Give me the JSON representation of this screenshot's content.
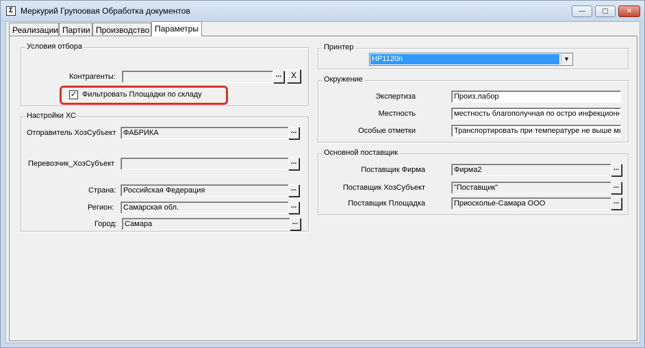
{
  "window": {
    "title": "Меркурий Групоовая Обработка документов",
    "app_icon_glyph": "Σ",
    "minimize_glyph": "—",
    "maximize_glyph": "▢",
    "close_glyph": "✕"
  },
  "tabs": [
    {
      "label": "Реализации"
    },
    {
      "label": "Партии"
    },
    {
      "label": "Производство"
    },
    {
      "label": "Параметры"
    }
  ],
  "active_tab": "Параметры",
  "selection_conditions": {
    "title": "Условия отбора",
    "counterparties_label": "Контрагенты:",
    "counterparties_value": "",
    "dots": "...",
    "clear": "X",
    "filter_checkbox_label": "Фильтровать Площадки по складу",
    "filter_checked": true,
    "check_glyph": "✓"
  },
  "hs_settings": {
    "title": "Настройки ХС",
    "sender_label": "Отправитель ХозСубъект",
    "sender_value": "ФАБРИКА",
    "carrier_label": "Перевозчик_ХозСубъект",
    "carrier_value": "",
    "country_label": "Страна:",
    "country_value": "Российская Федерация",
    "region_label": "Регион:",
    "region_value": "Самарская обл.",
    "city_label": "Город:",
    "city_value": "Самара"
  },
  "printer": {
    "title": "Принтер",
    "selected": "HP1120n",
    "arrow_glyph": "▼"
  },
  "environment": {
    "title": "Окружение",
    "expertise_label": "Экспертиза",
    "expertise_value": "Произ.лабор",
    "locality_label": "Местность",
    "locality_value": "местность благополучная по остро инфекционн",
    "notes_label": "Особые отметки",
    "notes_value": "Транспортировать при температуре не выше ми"
  },
  "main_supplier": {
    "title": "Основной поставщик",
    "firm_label": "Поставщик Фирма",
    "firm_value": "Фирма2",
    "entity_label": "Поставщик ХозСубъект",
    "entity_value": "\"Поставщик\"",
    "site_label": "Поставщик Площадка",
    "site_value": "Приосколье-Самара ООО"
  },
  "colors": {
    "highlight": "#d9302a",
    "selection": "#3399ff"
  }
}
